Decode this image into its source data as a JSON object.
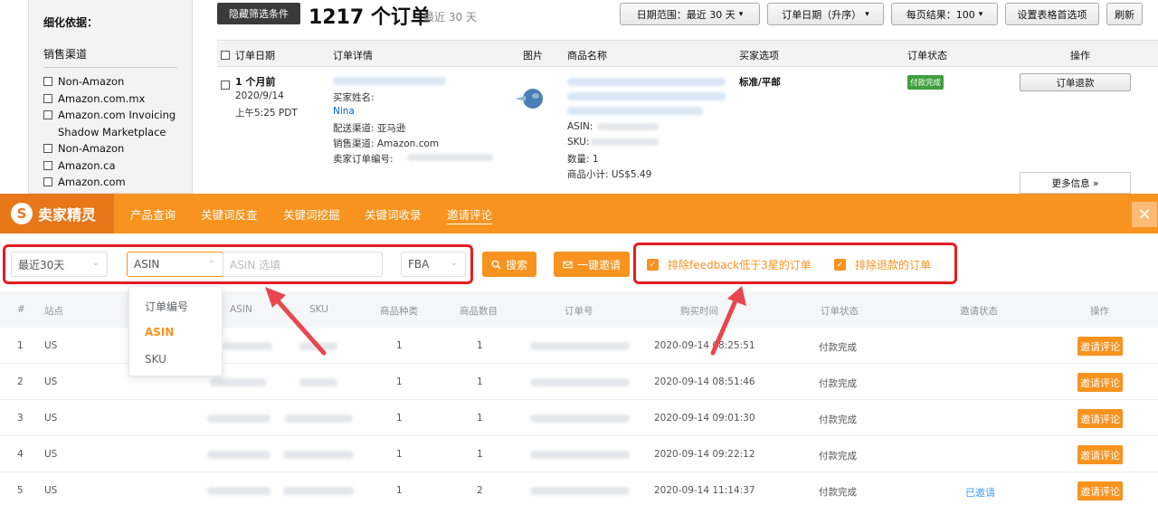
{
  "sidebar": {
    "heading": "细化依据：",
    "section": "销售渠道",
    "items": [
      "Non-Amazon",
      "Amazon.com.mx",
      "Amazon.com Invoicing Shadow Marketplace",
      "Non-Amazon",
      "Amazon.ca",
      "Amazon.com"
    ]
  },
  "topbar": {
    "hide_filters": "隐藏筛选条件",
    "order_count": "1217 个订单",
    "recent": "最近 30 天",
    "date_range": "日期范围：最近 30 天",
    "order_date_sort": "订单日期（升序）",
    "per_page": "每页结果：100",
    "table_prefs": "设置表格首选项",
    "refresh": "刷新"
  },
  "order_table": {
    "headers": [
      "订单日期",
      "订单详情",
      "图片",
      "商品名称",
      "买家选项",
      "订单状态",
      "操作"
    ],
    "row": {
      "relative_date": "1 个月前",
      "date": "2020/9/14",
      "time": "上午5:25 PDT",
      "buyer_label": "买家姓名:",
      "buyer_name": "Nina",
      "channel": "配送渠道: 亚马逊",
      "sales_channel": "销售渠道: Amazon.com",
      "seller_order": "卖家订单编号:",
      "asin_label": "ASIN:",
      "sku_label": "SKU:",
      "qty": "数量: 1",
      "subtotal": "商品小计: US$5.49",
      "shipping": "标准/平邮",
      "status": "付款完成",
      "refund": "订单退款",
      "more": "更多信息 »"
    }
  },
  "plugin": {
    "brand": "卖家精灵",
    "nav": [
      "产品查询",
      "关键词反查",
      "关键词挖掘",
      "关键词收录",
      "邀请评论"
    ],
    "active_nav": "邀请评论",
    "filters": {
      "period": "最近30天",
      "type": "ASIN",
      "asin_placeholder": "ASIN 选填",
      "fulfillment": "FBA",
      "search": "搜索",
      "invite_all": "一键邀请",
      "exclude_feedback": "排除feedback低于3星的订单",
      "exclude_refund": "排除退款的订单"
    },
    "dropdown": [
      "订单编号",
      "ASIN",
      "SKU"
    ],
    "table_headers": [
      "#",
      "站点",
      "ASIN",
      "SKU",
      "商品种类",
      "商品数目",
      "订单号",
      "购买时间",
      "订单状态",
      "邀请状态",
      "操作"
    ],
    "rows": [
      {
        "idx": "1",
        "site": "US",
        "kinds": "1",
        "count": "1",
        "time": "2020-09-14 08:25:51",
        "status": "付款完成",
        "invite": "",
        "action": "邀请评论"
      },
      {
        "idx": "2",
        "site": "US",
        "kinds": "1",
        "count": "1",
        "time": "2020-09-14 08:51:46",
        "status": "付款完成",
        "invite": "",
        "action": "邀请评论"
      },
      {
        "idx": "3",
        "site": "US",
        "kinds": "1",
        "count": "1",
        "time": "2020-09-14 09:01:30",
        "status": "付款完成",
        "invite": "",
        "action": "邀请评论"
      },
      {
        "idx": "4",
        "site": "US",
        "kinds": "1",
        "count": "1",
        "time": "2020-09-14 09:22:12",
        "status": "付款完成",
        "invite": "",
        "action": "邀请评论"
      },
      {
        "idx": "5",
        "site": "US",
        "kinds": "1",
        "count": "2",
        "time": "2020-09-14 11:14:37",
        "status": "付款完成",
        "invite": "已邀请",
        "action": "邀请评论"
      }
    ]
  },
  "colors": {
    "accent": "#f7931e",
    "highlight": "#e51c23",
    "link": "#409eff"
  }
}
